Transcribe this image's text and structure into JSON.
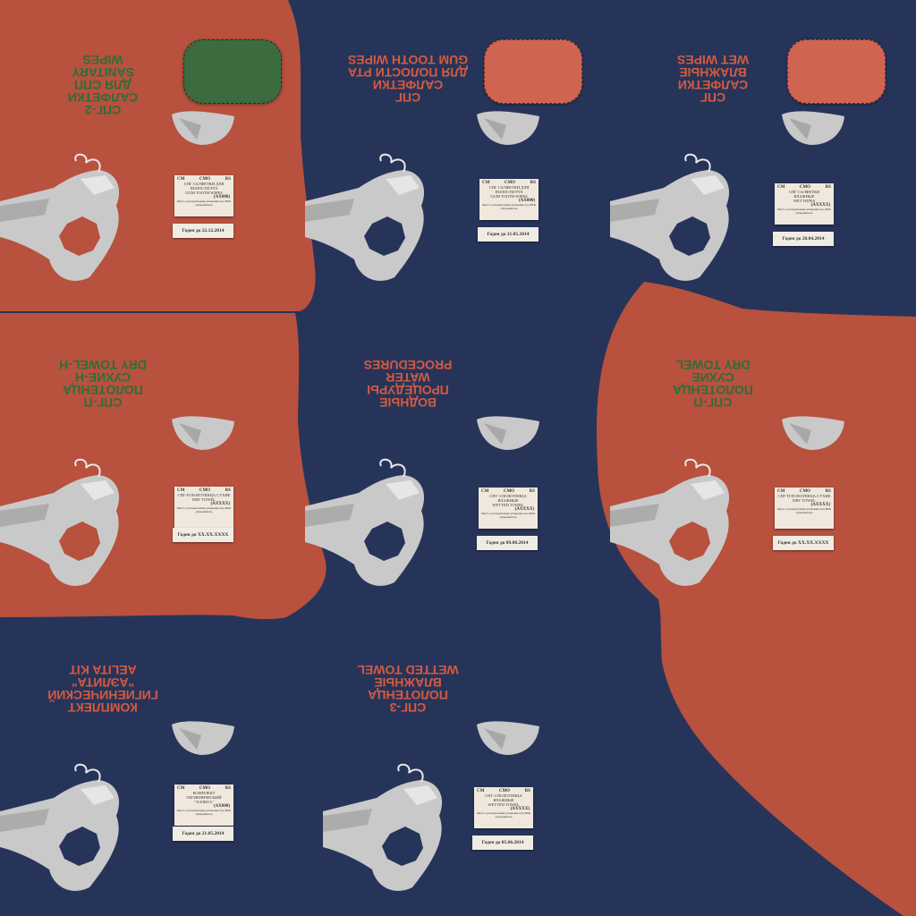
{
  "colors": {
    "navy": "#27345a",
    "orange": "#b8513d",
    "green_text": "#2c6e39",
    "orange_text": "#d55a3f",
    "grey": "#c9c9c9",
    "patch_green": "#3c6b3f",
    "patch_orange": "#cf6550"
  },
  "tiles": [
    {
      "heading": [
        "СПГ-2",
        "САЛФЕТКИ",
        "ДЛЯ СПП",
        "SANITARY",
        "WIPES"
      ],
      "heading_color": "green",
      "patch": "green",
      "bg": "orange",
      "label": {
        "corner_left": "СМ",
        "corner_mid": "СМО",
        "corner_right": "RS",
        "lines": [
          "СПГ САЛФЕТКИ ДЛЯ",
          "ПОЛОСТИ РТА",
          "GUM TOOTH WIPES"
        ],
        "code": "(АХ000)",
        "note": "Место для крепления упаковки под РКК «Дзержинск»"
      },
      "expiry": "Годен до 22.12.2014"
    },
    {
      "heading": [
        "СПГ",
        "САЛФЕТКИ",
        "ДЛЯ ПОЛОСТИ РТА",
        "GUM TOOTH WIPES"
      ],
      "heading_color": "orange",
      "patch": "orange",
      "bg": "navy",
      "label": {
        "corner_left": "СМ",
        "corner_mid": "СМО",
        "corner_right": "RS",
        "lines": [
          "СПГ САЛФЕТКИ ДЛЯ",
          "ПОЛОСТИ РТА",
          "GUM TOOTH WIPES"
        ],
        "code": "(АХ000)",
        "note": "Место для крепления упаковки под РКК «Дзержинск»"
      },
      "expiry": "Годен до 21.05.2014"
    },
    {
      "heading": [
        "СПГ",
        "САЛФЕТКИ",
        "ВЛАЖНЫЕ",
        "WET WIPES"
      ],
      "heading_color": "orange",
      "patch": "orange",
      "bg": "navy",
      "label": {
        "corner_left": "СМ",
        "corner_mid": "СМО",
        "corner_right": "RS",
        "lines": [
          "СПГ САЛФЕТКИ",
          "ВЛАЖНЫЕ",
          "WET WIPES"
        ],
        "code": "(АХХХХ)",
        "note": "Место для крепления упаковки под РКК «Дзержинск»"
      },
      "expiry": "Годен до 28.04.2014"
    },
    {
      "heading": [
        "СПГ-П",
        "ПОЛОТЕНЦА",
        "СУХИЕ-Н",
        "DRY TOWEL-H"
      ],
      "heading_color": "green",
      "patch": null,
      "bg": "orange",
      "label": {
        "corner_left": "СМ",
        "corner_mid": "СМО",
        "corner_right": "RS",
        "lines": [
          "СПГ-П ПОЛОТЕНЦА СУХИЕ",
          "DRY TOWEL"
        ],
        "code": "(АХХХХ)",
        "note": "Место для крепления упаковки под РКК «Дзержинск»"
      },
      "expiry": "Годен до XX.XX.XXXX"
    },
    {
      "heading": [
        "ВОДНЫЕ",
        "ПРОЦЕДУРЫ",
        "WATER",
        "PROCEDURES"
      ],
      "heading_color": "orange",
      "patch": null,
      "bg": "navy",
      "label": {
        "corner_left": "СМ",
        "corner_mid": "СМО",
        "corner_right": "RS",
        "lines": [
          "СПГ-3 ПОЛОТЕНЦА",
          "ВЛАЖНЫЕ",
          "WETTED TOWEL"
        ],
        "code": "(АХХХХ)",
        "note": "Место для крепления упаковки под РКК «Дзержинск»"
      },
      "expiry": "Годен до 09.08.2014"
    },
    {
      "heading": [
        "СПГ-П",
        "ПОЛОТЕНЦА",
        "СУХИЕ",
        "DRY TOWEL"
      ],
      "heading_color": "green",
      "patch": null,
      "bg": "orange",
      "label": {
        "corner_left": "СМ",
        "corner_mid": "СМО",
        "corner_right": "RS",
        "lines": [
          "СПГ-П ПОЛОТЕНЦА СУХИЕ",
          "DRY TOWEL"
        ],
        "code": "(АХХХХ)",
        "note": "Место для крепления упаковки под РКК «Дзержинск»"
      },
      "expiry": "Годен до XX.XX.XXXX"
    },
    {
      "heading": [
        "КОМПЛЕКТ",
        "ГИГИЕНИЧЕСКИЙ",
        "\"АЭЛИТА\"",
        "AELITA KIT"
      ],
      "heading_color": "orange",
      "patch": null,
      "bg": "navy",
      "label": {
        "corner_left": "СМ",
        "corner_mid": "СМО",
        "corner_right": "RS",
        "lines": [
          "КОМПЛЕКТ",
          "ГИГИЕНИЧЕСКИЙ",
          "\"АЭЛИТА\""
        ],
        "code": "(АХ000)",
        "note": "Место для крепления упаковки под РКК «Дзержинск»"
      },
      "expiry": "Годен до 21.05.2014"
    },
    {
      "heading": [
        "СПГ-3",
        "ПОЛОТЕНЦА",
        "ВЛАЖНЫЕ",
        "WETTED TOWEL"
      ],
      "heading_color": "orange",
      "patch": null,
      "bg": "navy",
      "label": {
        "corner_left": "СМ",
        "corner_mid": "СМО",
        "corner_right": "RS",
        "lines": [
          "СПГ-3 ПОЛОТЕНЦА",
          "ВЛАЖНЫЕ",
          "WETTED TOWEL"
        ],
        "code": "(АХХХХ)",
        "note": "Место для крепления упаковки под РКК «Дзержинск»"
      },
      "expiry": "Годен до 05.06.2014"
    }
  ]
}
